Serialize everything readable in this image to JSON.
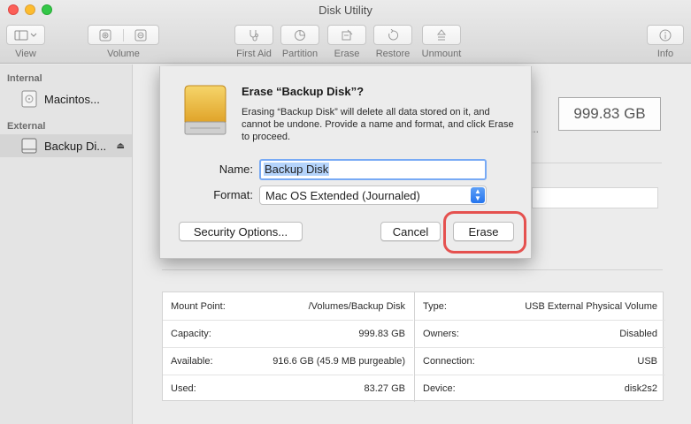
{
  "window": {
    "title": "Disk Utility"
  },
  "toolbar": {
    "view_label": "View",
    "volume_label": "Volume",
    "first_aid_label": "First Aid",
    "partition_label": "Partition",
    "erase_label": "Erase",
    "restore_label": "Restore",
    "unmount_label": "Unmount",
    "info_label": "Info"
  },
  "sidebar": {
    "internal_header": "Internal",
    "external_header": "External",
    "items": [
      {
        "label": "Macintos...",
        "icon": "internal-disk-icon"
      },
      {
        "label": "Backup Di...",
        "icon": "external-disk-icon",
        "selected": true
      }
    ]
  },
  "main": {
    "capacity_display": "999.83 GB",
    "ellipsis": "..."
  },
  "info": {
    "left": [
      {
        "label": "Mount Point:",
        "value": "/Volumes/Backup Disk"
      },
      {
        "label": "Capacity:",
        "value": "999.83 GB"
      },
      {
        "label": "Available:",
        "value": "916.6 GB (45.9 MB purgeable)"
      },
      {
        "label": "Used:",
        "value": "83.27 GB"
      }
    ],
    "right": [
      {
        "label": "Type:",
        "value": "USB External Physical Volume"
      },
      {
        "label": "Owners:",
        "value": "Disabled"
      },
      {
        "label": "Connection:",
        "value": "USB"
      },
      {
        "label": "Device:",
        "value": "disk2s2"
      }
    ]
  },
  "dialog": {
    "title": "Erase “Backup Disk”?",
    "message": "Erasing “Backup Disk” will delete all data stored on it, and cannot be undone. Provide a name and format, and click Erase to proceed.",
    "name_label": "Name:",
    "name_value": "Backup Disk",
    "format_label": "Format:",
    "format_value": "Mac OS Extended (Journaled)",
    "security_button": "Security Options...",
    "cancel_button": "Cancel",
    "erase_button": "Erase"
  },
  "colors": {
    "highlight": "#e5514f",
    "selection": "#b4d3fb",
    "focus_ring": "#78aaf5",
    "select_arrows": "#2474ee"
  }
}
